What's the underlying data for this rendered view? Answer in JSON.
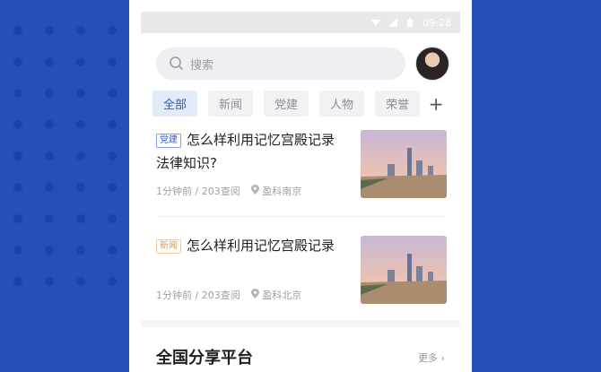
{
  "status": {
    "time": "09:28"
  },
  "search": {
    "placeholder": "搜索"
  },
  "tabs": [
    {
      "label": "全部",
      "active": true
    },
    {
      "label": "新闻",
      "active": false
    },
    {
      "label": "党建",
      "active": false
    },
    {
      "label": "人物",
      "active": false
    },
    {
      "label": "荣誉",
      "active": false
    }
  ],
  "tab_add_symbol": "+",
  "articles": [
    {
      "tag": "党建",
      "title": "怎么样利用记忆宫殿记录法律知识?",
      "time": "1分钟前",
      "views": "203查阅",
      "location": "盈科南京"
    },
    {
      "tag": "新闻",
      "title": "怎么样利用记忆宫殿记录",
      "time": "1分钟前",
      "views": "203查阅",
      "location": "盈科北京"
    }
  ],
  "section": {
    "title": "全国分享平台",
    "more": "更多"
  },
  "colors": {
    "accent": "#2f5bbd",
    "background": "#2450b8",
    "news_tag": "#e09a55"
  }
}
